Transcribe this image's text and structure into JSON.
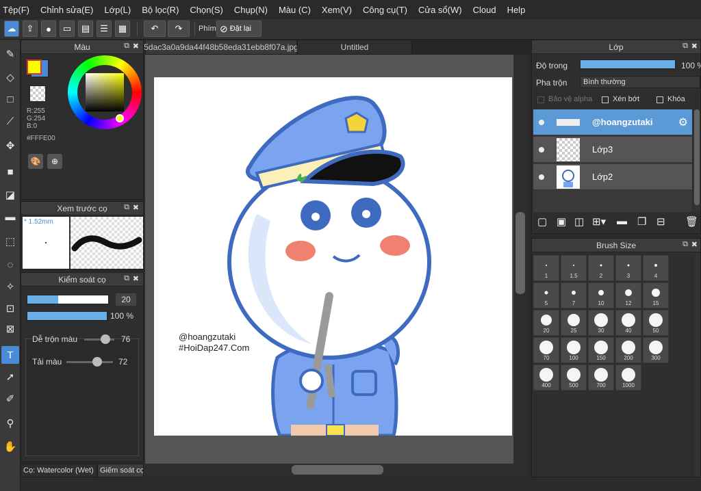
{
  "menu": [
    "Tệp(F)",
    "Chỉnh sửa(E)",
    "Lớp(L)",
    "Bộ lọc(R)",
    "Chọn(S)",
    "Chụp(N)",
    "Màu (C)",
    "Xem(V)",
    "Công cụ(T)",
    "Cửa sổ(W)",
    "Cloud",
    "Help"
  ],
  "toolbar": {
    "shortcut_label": "Phím",
    "reset_label": "Đặt lại"
  },
  "color_panel": {
    "title": "Màu",
    "r": "R:255",
    "g": "G:254",
    "b": "B:0",
    "hex": "#FFFE00",
    "fg_color": "#FFFE00",
    "bg_color": "#4a8ad6"
  },
  "brush_preview": {
    "title": "Xem trước cọ",
    "size": "* 1.52mm"
  },
  "brush_control": {
    "title": "Kiểm soát cọ",
    "size_value": "20",
    "opacity_value": "100 %",
    "blend_label": "Dễ trộn màu",
    "blend_value": "76",
    "dilution_label": "Tải màu",
    "dilution_value": "72",
    "size_fraction": 0.38,
    "opacity_fraction": 1.0,
    "blend_fraction": 0.76,
    "dilution_fraction": 0.72
  },
  "bottom_tabs": [
    "Cọ: Watercolor (Wet)",
    "Giếm soát cọ"
  ],
  "doc_tabs": [
    "5dac3a0a9da44f48b58eda31ebb8f07a.jpg",
    "Untitled"
  ],
  "canvas_text": {
    "line1": "@hoangzutaki",
    "line2": "#HoiDap247.Com"
  },
  "layers_panel": {
    "title": "Lớp",
    "opacity_label": "Độ trong",
    "opacity_value": "100 %",
    "blend_label": "Pha trộn",
    "blend_value": "Bình thường",
    "protect_alpha": "Bảo vệ alpha",
    "clipping": "Xén bớt",
    "lock": "Khóa",
    "layers": [
      {
        "name": "@hoangzutaki",
        "selected": true
      },
      {
        "name": "Lớp3",
        "selected": false
      },
      {
        "name": "Lớp2",
        "selected": false
      }
    ]
  },
  "brush_size": {
    "title": "Brush Size",
    "sizes": [
      "1",
      "1.5",
      "2",
      "3",
      "4",
      "5",
      "7",
      "10",
      "12",
      "15",
      "20",
      "25",
      "30",
      "40",
      "50",
      "70",
      "100",
      "150",
      "200",
      "300",
      "400",
      "500",
      "700",
      "1000"
    ]
  }
}
